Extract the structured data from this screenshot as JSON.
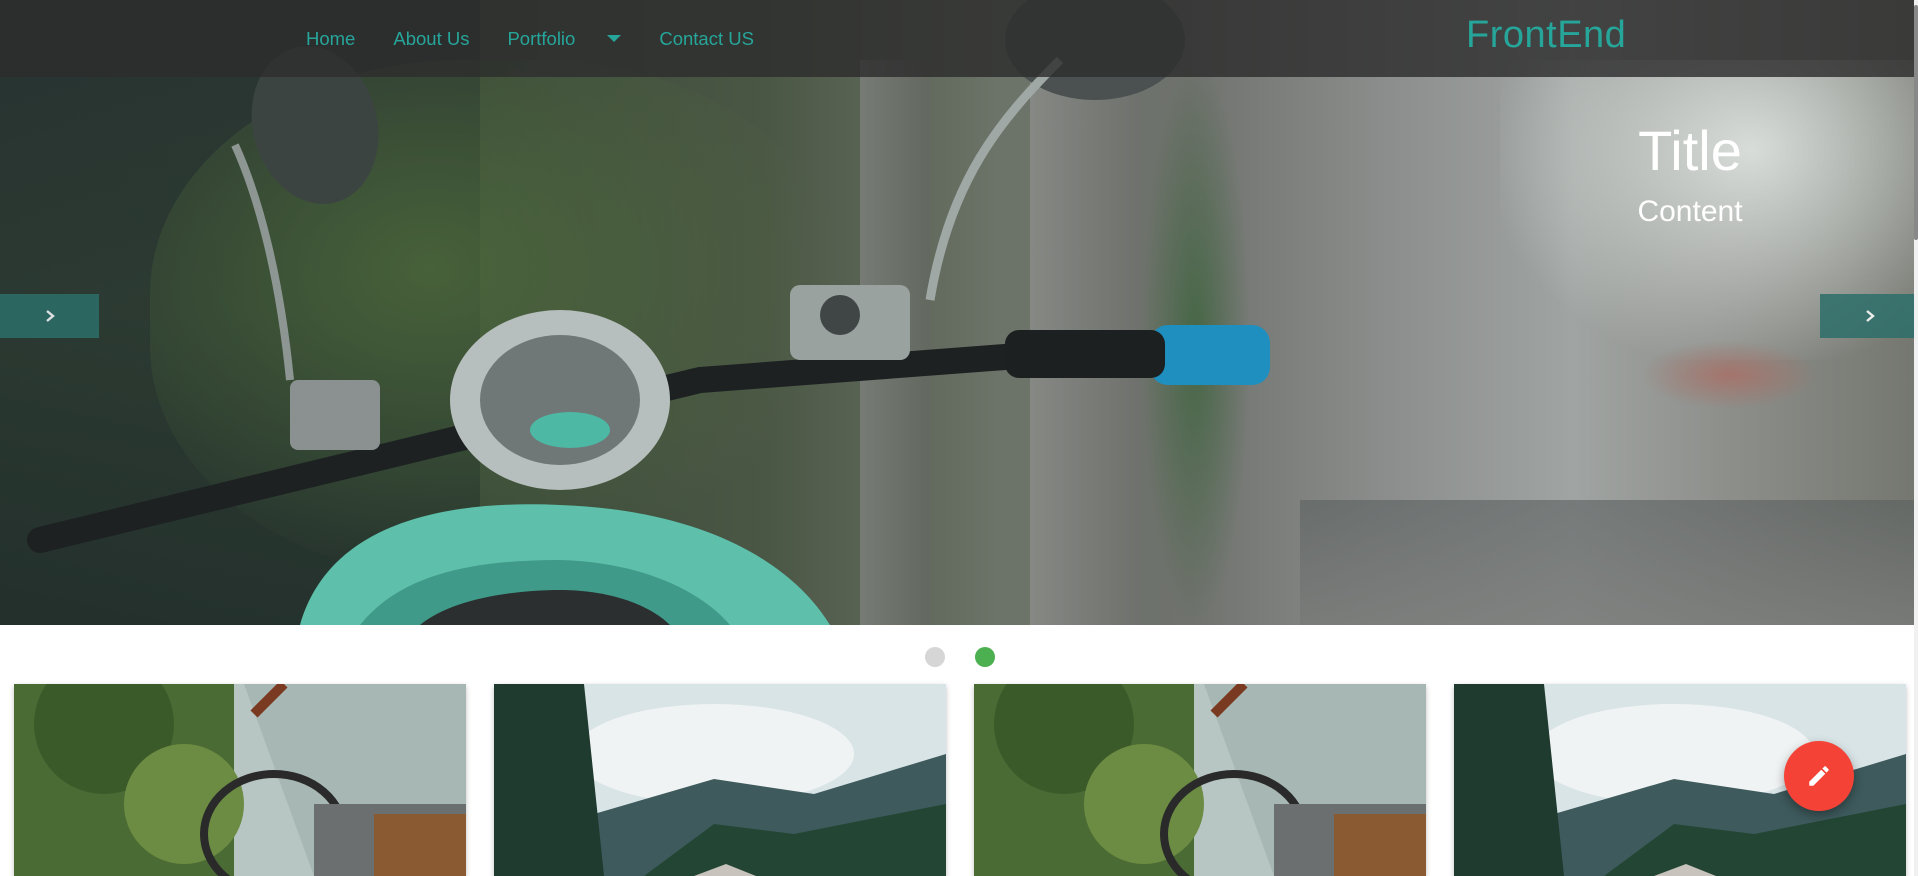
{
  "navbar": {
    "links": [
      {
        "label": "Home"
      },
      {
        "label": "About Us"
      },
      {
        "label": "Portfolio"
      },
      {
        "label": "Contact US"
      }
    ],
    "brand": "FrontEnd"
  },
  "hero": {
    "caption_title": "Title",
    "caption_content": "Content"
  },
  "slider": {
    "slide_count": 2,
    "active_index": 1
  },
  "icons": {
    "prev": "chevron-right-icon",
    "next": "chevron-right-icon",
    "portfolio_dropdown": "caret-down-icon",
    "fab": "edit-pencil-icon"
  },
  "colors": {
    "accent": "#26a69a",
    "nav_background": "rgba(45,45,45,0.82)",
    "dot_active": "#4caf50",
    "dot_inactive": "#d6d6d6",
    "fab": "#f44336",
    "arrow_background": "#2d6e6a"
  }
}
